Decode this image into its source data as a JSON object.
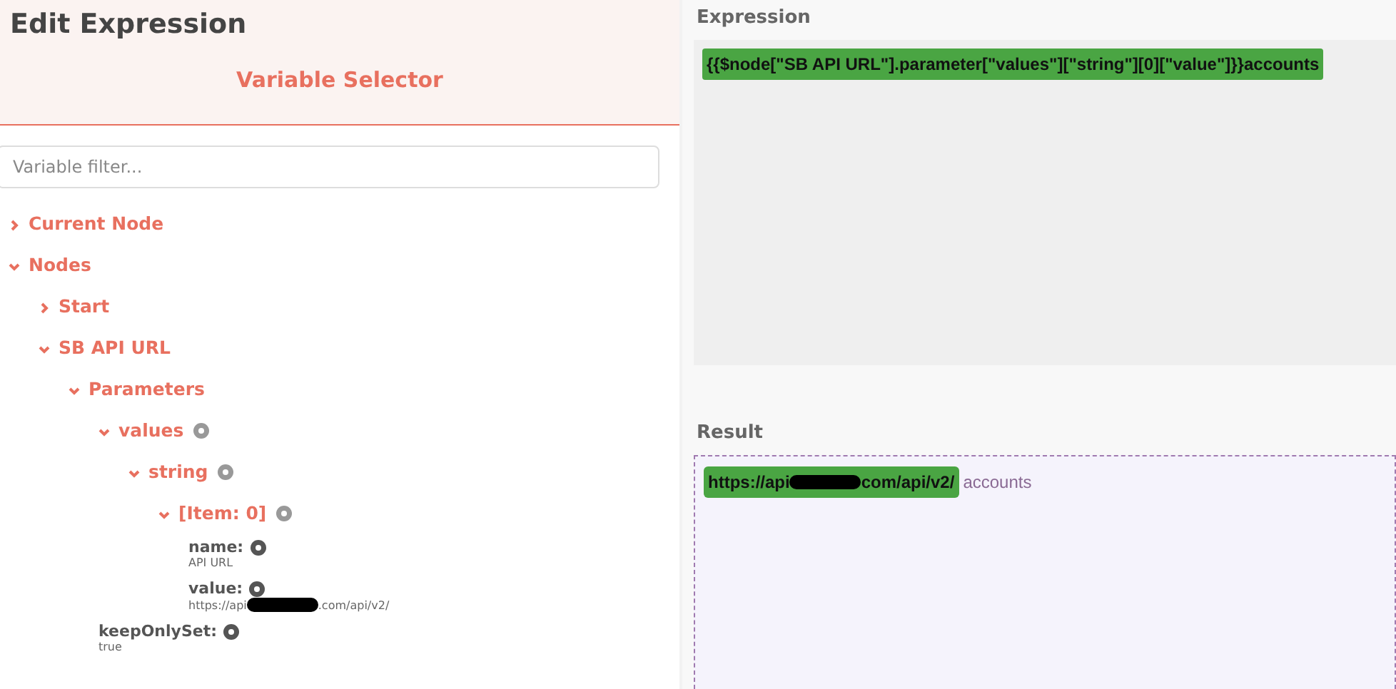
{
  "title": "Edit Expression",
  "selector": {
    "heading": "Variable Selector",
    "filter": {
      "placeholder": "Variable filter..."
    },
    "tree": [
      {
        "kind": "group",
        "label": "Current Node",
        "expanded": false
      },
      {
        "kind": "group",
        "label": "Nodes",
        "expanded": true,
        "children": [
          {
            "kind": "group",
            "label": "Start",
            "expanded": false
          },
          {
            "kind": "group",
            "label": "SB API URL",
            "expanded": true,
            "children": [
              {
                "kind": "group",
                "label": "Parameters",
                "expanded": true,
                "children": [
                  {
                    "kind": "property",
                    "label": "values",
                    "expanded": true,
                    "children": [
                      {
                        "kind": "property",
                        "label": "string",
                        "expanded": true,
                        "children": [
                          {
                            "kind": "property",
                            "label": "[Item: 0]",
                            "expanded": true,
                            "children": [
                              {
                                "kind": "leaf",
                                "label": "name:",
                                "value_parts": [
                                  "API URL"
                                ]
                              },
                              {
                                "kind": "leaf",
                                "label": "value:",
                                "value_parts": [
                                  "https://api",
                                  ".com/api/v2/"
                                ]
                              }
                            ]
                          }
                        ]
                      }
                    ]
                  },
                  {
                    "kind": "leaf",
                    "label": "keepOnlySet:",
                    "value_parts": [
                      "true"
                    ]
                  }
                ]
              }
            ]
          }
        ]
      }
    ]
  },
  "expression": {
    "label": "Expression",
    "value": "{{$node[\"SB API URL\"].parameter[\"values\"][\"string\"][0][\"value\"]}}accounts"
  },
  "result": {
    "label": "Result",
    "resolved_parts": [
      "https://api",
      "com/api/v2/"
    ],
    "text": "accounts"
  }
}
